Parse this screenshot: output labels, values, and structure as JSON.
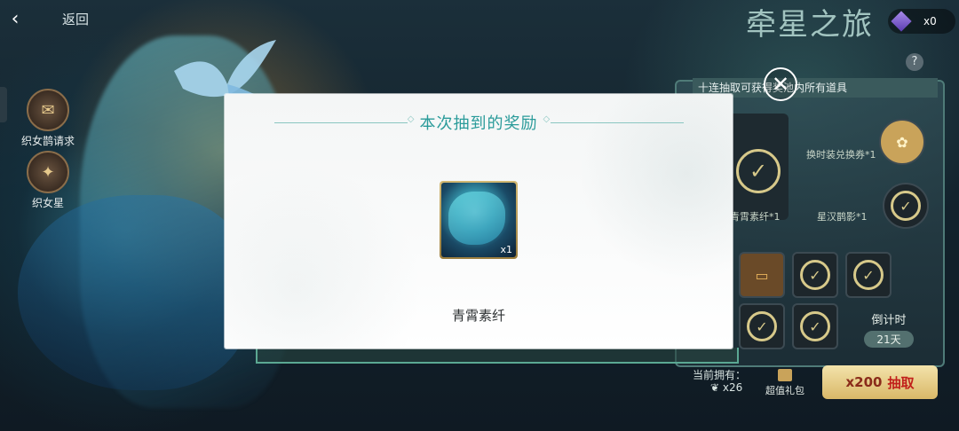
{
  "top_bar": {
    "back_label": "返回",
    "gem_count": "x0"
  },
  "side_menu": [
    {
      "label": "织女鹊请求",
      "icon": "scroll-icon"
    },
    {
      "label": "织女星",
      "icon": "star-icon"
    }
  ],
  "event_title": "牵星之旅",
  "help": "?",
  "panel": {
    "banner": "十连抽取可获得奖池内所有道具",
    "rewards": [
      "青霄素纤*1",
      "星汉鹊影*1",
      "换时装兑换券*1"
    ],
    "countdown_label": "倒计时",
    "countdown_value": "21天"
  },
  "bottom": {
    "owned_label": "当前拥有：",
    "owned_count": "x26",
    "gift_label": "超值礼包",
    "draw_cost": "x200",
    "draw_label": "抽取"
  },
  "dialog": {
    "title": "本次抽到的奖励",
    "item_name": "青霄素纤",
    "item_qty": "x1"
  },
  "colors": {
    "accent": "#2a9b9a",
    "frame": "#5ba893",
    "check": "#d7c98a"
  }
}
